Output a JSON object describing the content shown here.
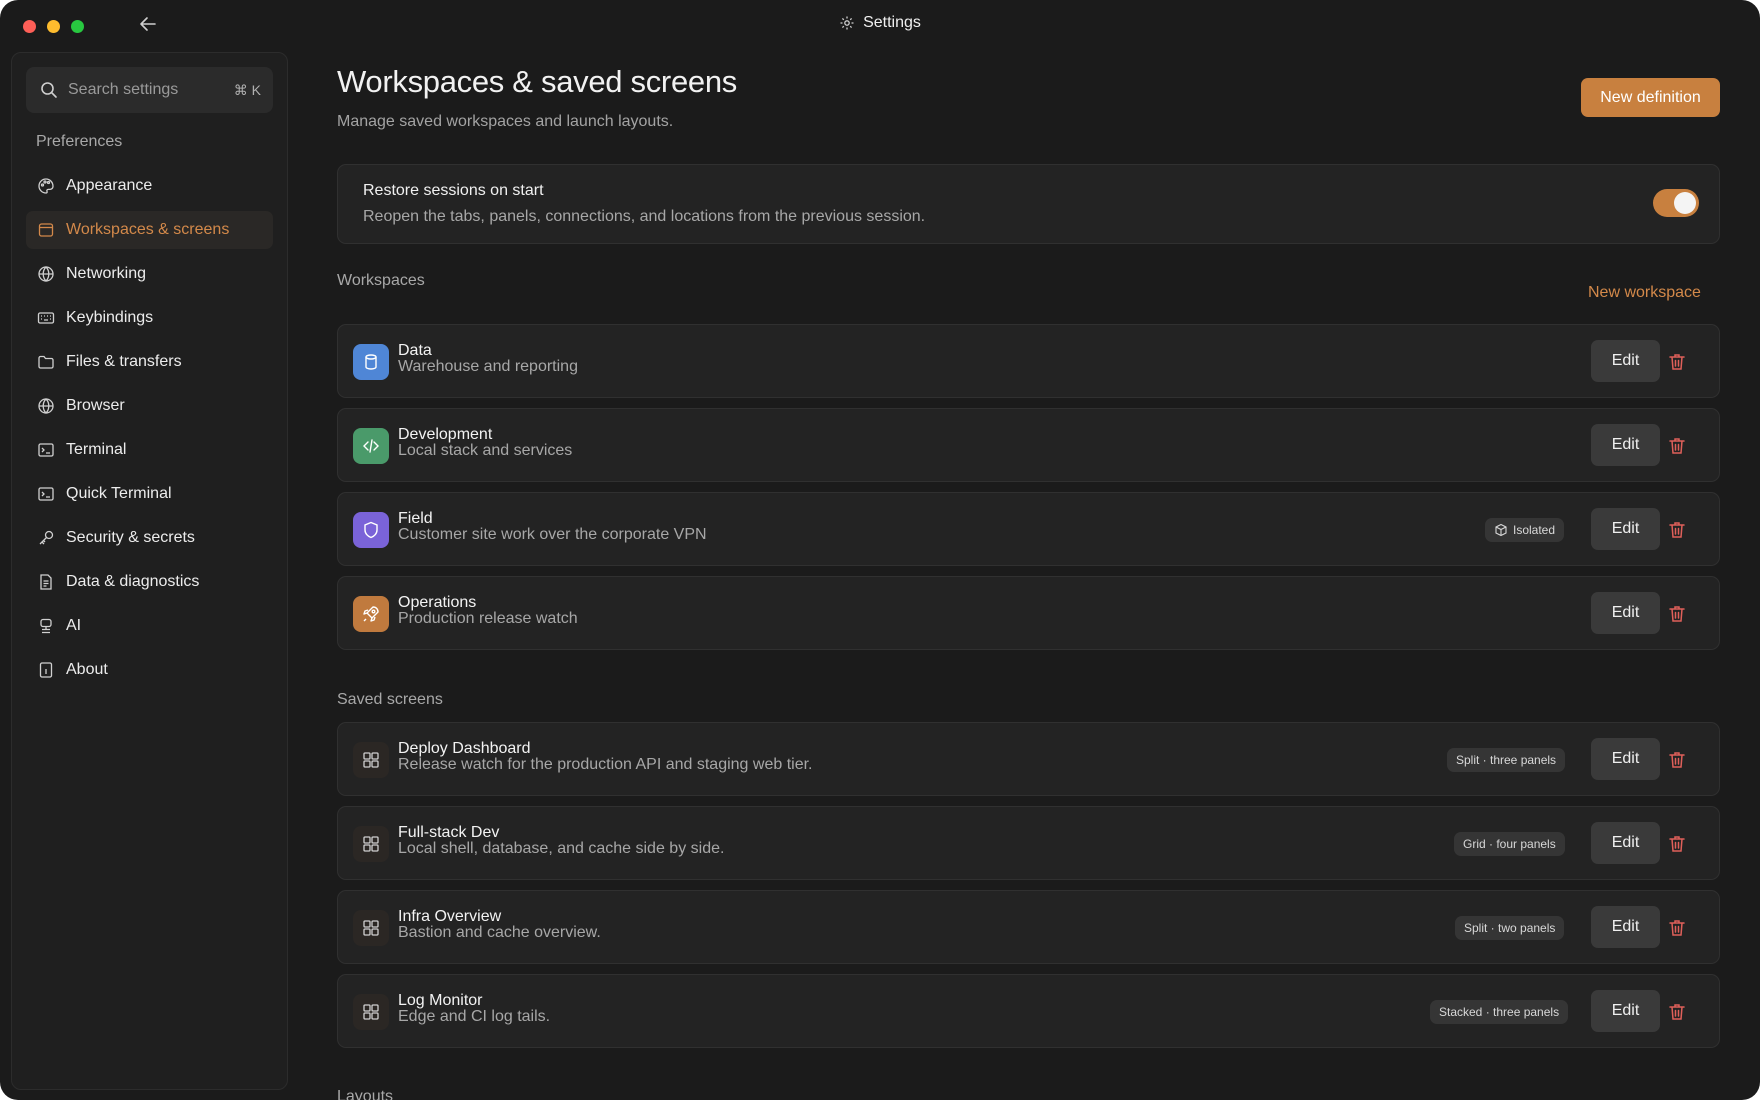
{
  "window": {
    "title": "Settings"
  },
  "sidebar": {
    "search_placeholder": "Search settings",
    "shortcut": "⌘ K",
    "heading": "Preferences",
    "items": [
      {
        "label": "Appearance",
        "icon": "palette-icon",
        "active": false
      },
      {
        "label": "Workspaces & screens",
        "icon": "window-icon",
        "active": true
      },
      {
        "label": "Networking",
        "icon": "globe-icon",
        "active": false
      },
      {
        "label": "Keybindings",
        "icon": "keyboard-icon",
        "active": false
      },
      {
        "label": "Files & transfers",
        "icon": "folder-icon",
        "active": false
      },
      {
        "label": "Browser",
        "icon": "globe-icon",
        "active": false
      },
      {
        "label": "Terminal",
        "icon": "terminal-icon",
        "active": false
      },
      {
        "label": "Quick Terminal",
        "icon": "terminal-icon",
        "active": false
      },
      {
        "label": "Security & secrets",
        "icon": "key-icon",
        "active": false
      },
      {
        "label": "Data & diagnostics",
        "icon": "document-icon",
        "active": false
      },
      {
        "label": "AI",
        "icon": "robot-icon",
        "active": false
      },
      {
        "label": "About",
        "icon": "info-icon",
        "active": false
      }
    ]
  },
  "main": {
    "title": "Workspaces & saved screens",
    "subtitle": "Manage saved workspaces and launch layouts.",
    "new_definition_label": "New definition",
    "restore": {
      "title": "Restore sessions on start",
      "description": "Reopen the tabs, panels, connections, and locations from the previous session.",
      "enabled": true
    },
    "workspaces_label": "Workspaces",
    "new_workspace_label": "New workspace",
    "workspaces": [
      {
        "name": "Data",
        "description": "Warehouse and reporting",
        "icon": "database-icon",
        "color": "#4f86d6",
        "badge": "",
        "edit_label": "Edit"
      },
      {
        "name": "Development",
        "description": "Local stack and services",
        "icon": "code-icon",
        "color": "#4a9a6a",
        "badge": "",
        "edit_label": "Edit"
      },
      {
        "name": "Field",
        "description": "Customer site work over the corporate VPN",
        "icon": "shield-icon",
        "color": "#7a63d8",
        "badge": "Isolated",
        "edit_label": "Edit"
      },
      {
        "name": "Operations",
        "description": "Production release watch",
        "icon": "rocket-icon",
        "color": "#c07a3e",
        "badge": "",
        "edit_label": "Edit"
      }
    ],
    "saved_screens_label": "Saved screens",
    "saved_screens": [
      {
        "name": "Deploy Dashboard",
        "description": "Release watch for the production API and staging web tier.",
        "badge": "Split · three panels",
        "edit_label": "Edit"
      },
      {
        "name": "Full-stack Dev",
        "description": "Local shell, database, and cache side by side.",
        "badge": "Grid · four panels",
        "edit_label": "Edit"
      },
      {
        "name": "Infra Overview",
        "description": "Bastion and cache overview.",
        "badge": "Split · two panels",
        "edit_label": "Edit"
      },
      {
        "name": "Log Monitor",
        "description": "Edge and CI log tails.",
        "badge": "Stacked · three panels",
        "edit_label": "Edit"
      }
    ],
    "layouts_label": "Layouts"
  },
  "colors": {
    "accent": "#c8803f",
    "danger": "#e0605a"
  }
}
